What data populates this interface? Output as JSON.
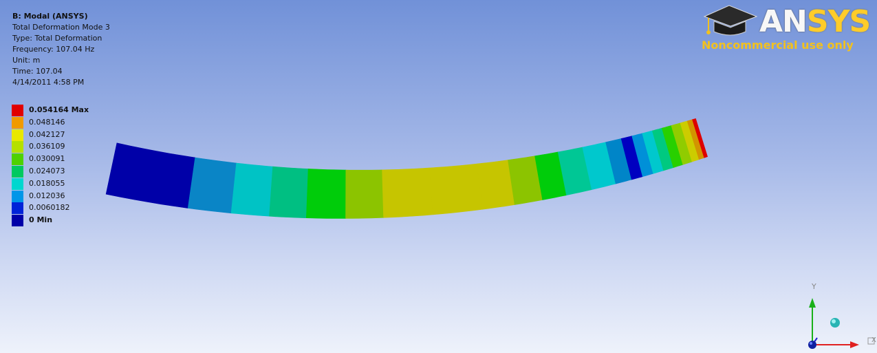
{
  "info": {
    "title": "B: Modal (ANSYS)",
    "lines": [
      "Total Deformation Mode 3",
      "Type: Total Deformation",
      "Frequency: 107.04 Hz",
      "Unit: m",
      "Time: 107.04",
      "4/14/2011 4:58 PM"
    ]
  },
  "legend": [
    {
      "label": "0.054164 Max",
      "color": "#e00000",
      "bold": true
    },
    {
      "label": "0.048146",
      "color": "#f09a00",
      "bold": false
    },
    {
      "label": "0.042127",
      "color": "#e8e800",
      "bold": false
    },
    {
      "label": "0.036109",
      "color": "#b5e000",
      "bold": false
    },
    {
      "label": "0.030091",
      "color": "#4ed100",
      "bold": false
    },
    {
      "label": "0.024073",
      "color": "#00c95f",
      "bold": false
    },
    {
      "label": "0.018055",
      "color": "#00d7cf",
      "bold": false
    },
    {
      "label": "0.012036",
      "color": "#0096e8",
      "bold": false
    },
    {
      "label": "0.0060182",
      "color": "#0023d8",
      "bold": false
    },
    {
      "label": "0 Min",
      "color": "#0000a8",
      "bold": true
    }
  ],
  "logo": {
    "brand_main": "AN",
    "brand_sys": "SYS",
    "reg_mark": "®",
    "note": "Noncommercial use only"
  },
  "triad": {
    "x_label": "X",
    "y_label": "Y"
  },
  "beam_band_colors": [
    "#0000a8",
    "#0a85c6",
    "#00c3c5",
    "#00bf82",
    "#00cc0a",
    "#8cc400",
    "#c6c500",
    "#c6c500",
    "#c6c500",
    "#8cc400",
    "#00cc0a",
    "#00c795",
    "#00c8cd",
    "#0085c8",
    "#0000c0",
    "#0090d8",
    "#00c8cd",
    "#00c980",
    "#28d000",
    "#90cc00",
    "#cccc00",
    "#d29400",
    "#dd0000"
  ]
}
